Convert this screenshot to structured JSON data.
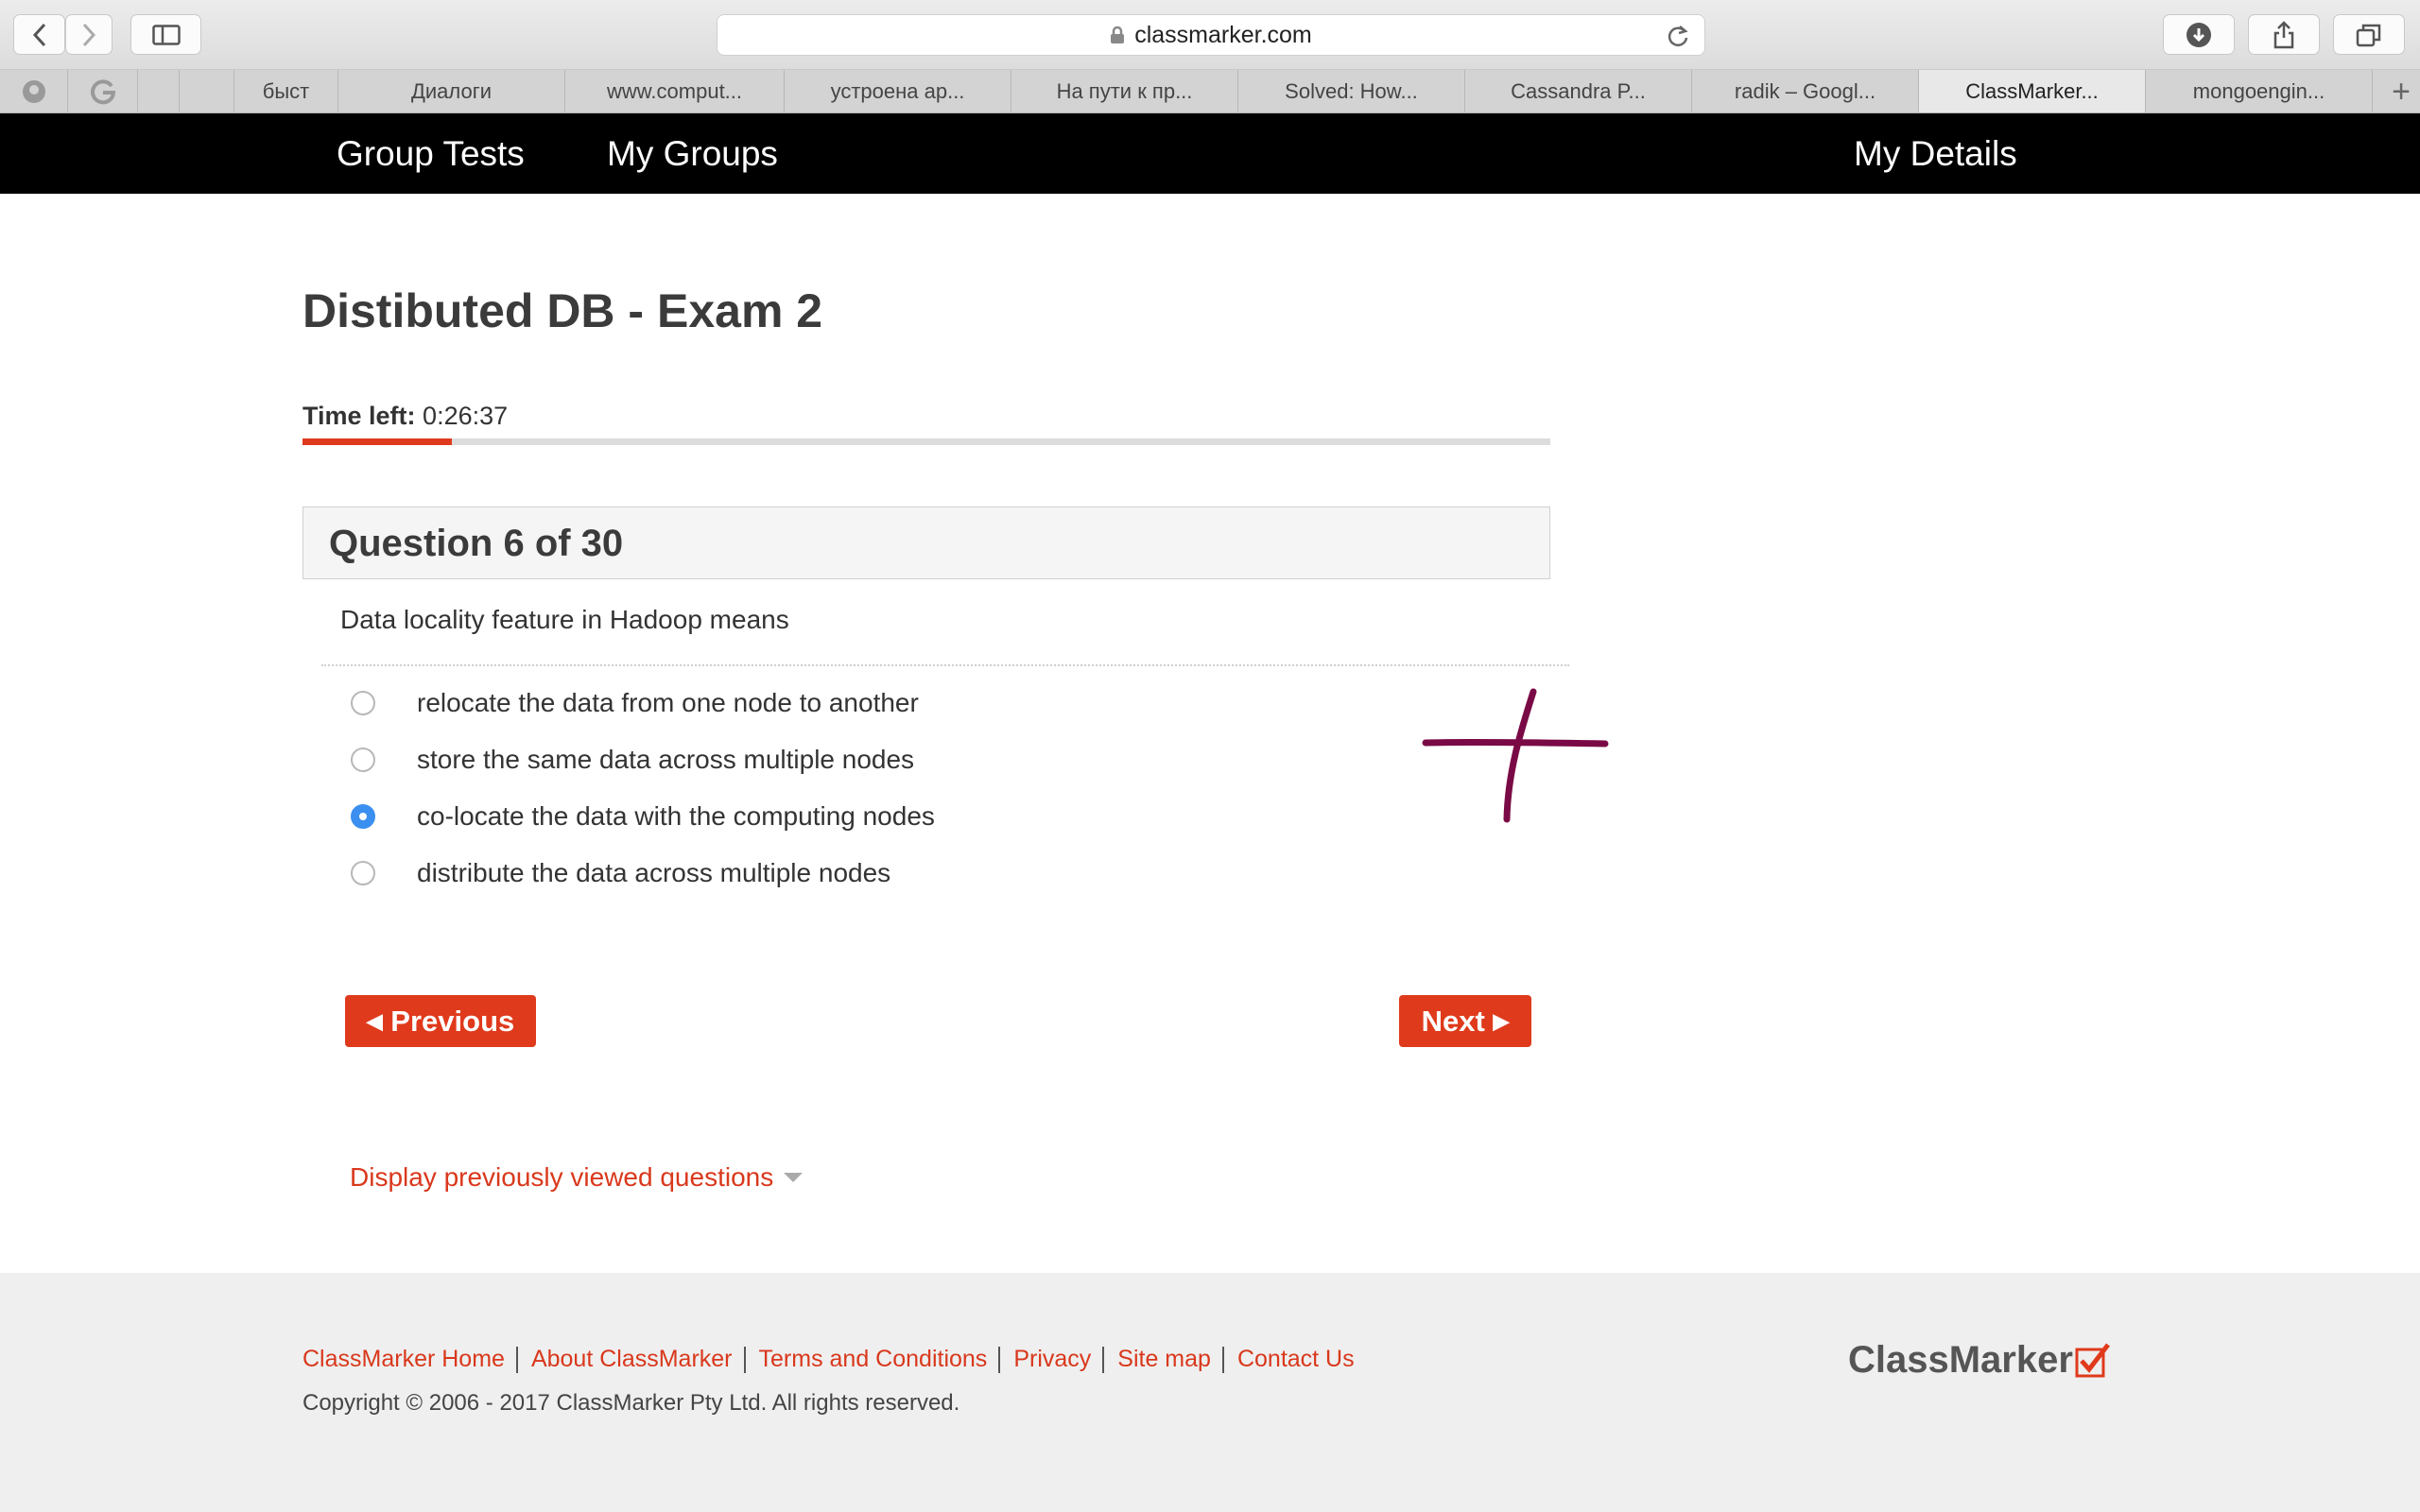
{
  "browser": {
    "url": "classmarker.com",
    "tabs": [
      {
        "label": "быст",
        "active": false
      },
      {
        "label": "Диалоги",
        "active": false
      },
      {
        "label": "www.comput...",
        "active": false
      },
      {
        "label": "устроена ар...",
        "active": false
      },
      {
        "label": "На пути к пр...",
        "active": false
      },
      {
        "label": "Solved: How...",
        "active": false
      },
      {
        "label": "Cassandra P...",
        "active": false
      },
      {
        "label": "radik – Googl...",
        "active": false
      },
      {
        "label": "ClassMarker...",
        "active": true
      },
      {
        "label": "mongoengin...",
        "active": false
      }
    ],
    "new_tab": "+"
  },
  "nav": {
    "group_tests": "Group Tests",
    "my_groups": "My Groups",
    "my_details": "My Details"
  },
  "exam": {
    "title": "Distibuted DB - Exam 2",
    "time_left_label": "Time left:",
    "time_left_value": "0:26:37",
    "time_progress_fraction": 0.12,
    "question_header": "Question 6 of 30",
    "question_text": "Data locality feature in Hadoop means",
    "options": [
      {
        "label": "relocate the data from one node to another",
        "selected": false
      },
      {
        "label": "store the same data across multiple nodes",
        "selected": false
      },
      {
        "label": "co-locate the data with the computing nodes",
        "selected": true
      },
      {
        "label": "distribute the data across multiple nodes",
        "selected": false
      }
    ],
    "previous_label": "Previous",
    "next_label": "Next",
    "display_previous_label": "Display previously viewed questions"
  },
  "footer": {
    "links": [
      "ClassMarker Home",
      "About ClassMarker",
      "Terms and Conditions",
      "Privacy",
      "Site map",
      "Contact Us"
    ],
    "copyright": "Copyright © 2006 - 2017 ClassMarker Pty Ltd. All rights reserved.",
    "logo_text": "ClassMarker"
  },
  "colors": {
    "accent": "#df3a1c",
    "radio_selected": "#3b8ff0",
    "annotation": "#7a0a45"
  }
}
